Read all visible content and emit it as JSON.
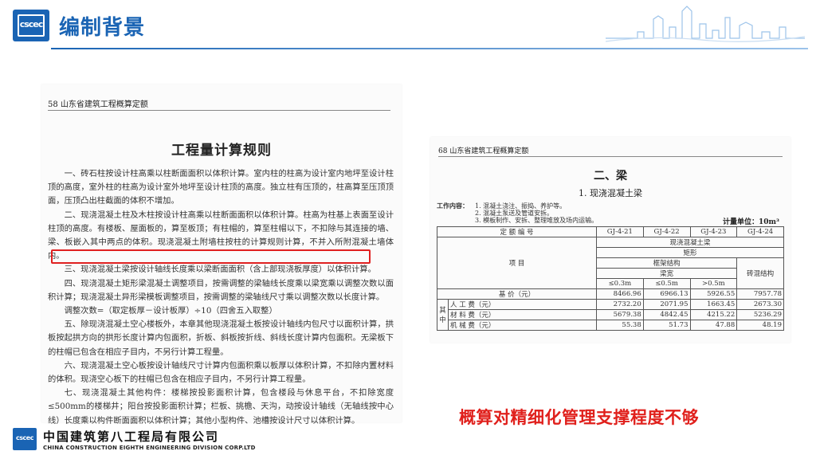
{
  "header": {
    "logo_text": "cscec",
    "title": "编制背景"
  },
  "doc1": {
    "page_header": "58    山东省建筑工程概算定额",
    "heading": "工程量计算规则",
    "paragraphs": [
      "一、砖石柱按设计柱高乘以柱断面面积以体积计算。室内柱的柱高为设计室内地坪至设计柱顶的高度，室外柱的柱高为设计室外地坪至设计柱顶的高度。独立柱有压顶的，柱高算至压顶顶面，压顶凸出柱截面的体积不增加。",
      "二、现浇混凝土柱及木柱按设计柱高乘以柱断面面积以体积计算。柱高为柱基上表面至设计柱顶的高度。有楼板、屋面板的，算至板顶；有柱帽的，算至柱帽以下，不扣除与其连接的墙、梁、板嵌入其中两点的体积。现浇混凝土附墙柱按柱的计算规则计算，不并入所附混凝土墙体内。",
      "三、现浇混凝土梁按设计轴线长度乘以梁断面面积（含上部现浇板厚度）以体积计算。",
      "四、现浇混凝土矩形梁混凝土调整项目，按需调整的梁轴线长度乘以梁宽乘以调整次数以面积计算；现浇混凝土异形梁模板调整项目，按需调整的梁轴线尺寸乘以调整次数以长度计算。",
      "调整次数=（取定板厚－设计板厚）÷10（四舍五入取整）",
      "五、除现浇混凝土空心楼板外，本章其他现浇混凝土板按设计轴线内包尺寸以面积计算，拱板按起拱方向的拱形长度计算内包面积，折板、斜板按折线、斜线长度计算内包面积。无梁板下的柱帽已包含在相应子目内，不另行计算工程量。",
      "六、现浇混凝土空心板按设计轴线尺寸计算内包面积乘以板厚以体积计算，不扣除内置材料的体积。现浇空心板下的柱帽已包含在相应子目内，不另行计算工程量。",
      "七、现浇混凝土其他构件：楼梯按投影面积计算，包含楼段与休息平台，不扣除宽度≤500mm的楼梯井；阳台按投影面积计算；栏板、挑檐、天沟，动按设计轴线（无轴线按中心线）长度乘以构件断面面积以体积计算；其他小型构件、池槽按设计尺寸以体积计算。"
    ]
  },
  "doc2": {
    "page_header": "68    山东省建筑工程概算定额",
    "section": "二、梁",
    "subsection": "1. 现浇混凝土梁",
    "work_label": "工作内容：",
    "work_items": [
      "1. 混凝土浇注、振捣、养护等。",
      "2. 混凝土泵送及管道安拆。",
      "3. 模板制作、安拆、整理堆放及场内运输。"
    ],
    "unit": "计量单位：10m³",
    "table": {
      "code_label": "定  额  编  号",
      "codes": [
        "GJ-4-21",
        "GJ-4-22",
        "GJ-4-23",
        "GJ-4-24"
      ],
      "item_label": "项            目",
      "row_a": "现浇混凝土梁",
      "row_b": "矩形",
      "row_c": "框架结构",
      "row_d": "梁宽",
      "masonry": "砖混结构",
      "widths": [
        "≤0.3m",
        "≤0.5m",
        ">0.5m"
      ],
      "base_label": "基            价（元）",
      "base": [
        "8466.96",
        "6966.13",
        "5926.55",
        "7957.78"
      ],
      "group_label_1": "其",
      "group_label_2": "中",
      "labor_label": "人      工      费（元）",
      "labor": [
        "2732.20",
        "2071.95",
        "1663.45",
        "2673.30"
      ],
      "material_label": "材      料      费（元）",
      "material": [
        "5679.38",
        "4842.45",
        "4215.22",
        "5236.29"
      ],
      "machine_label": "机      械      费（元）",
      "machine": [
        "55.38",
        "51.73",
        "47.88",
        "48.19"
      ]
    }
  },
  "subtitle": "概算对精细化管理支撑程度不够",
  "footer": {
    "logo_text": "cscec",
    "company_cn": "中国建筑第八工程局有限公司",
    "company_en": "CHINA CONSTRUCTION EIGHTH ENGINEERING DIVISION CORP.LTD"
  },
  "colors": {
    "brand_blue": "#1a64b4",
    "highlight_red": "#e02020",
    "subtitle_red": "#e0201c"
  }
}
